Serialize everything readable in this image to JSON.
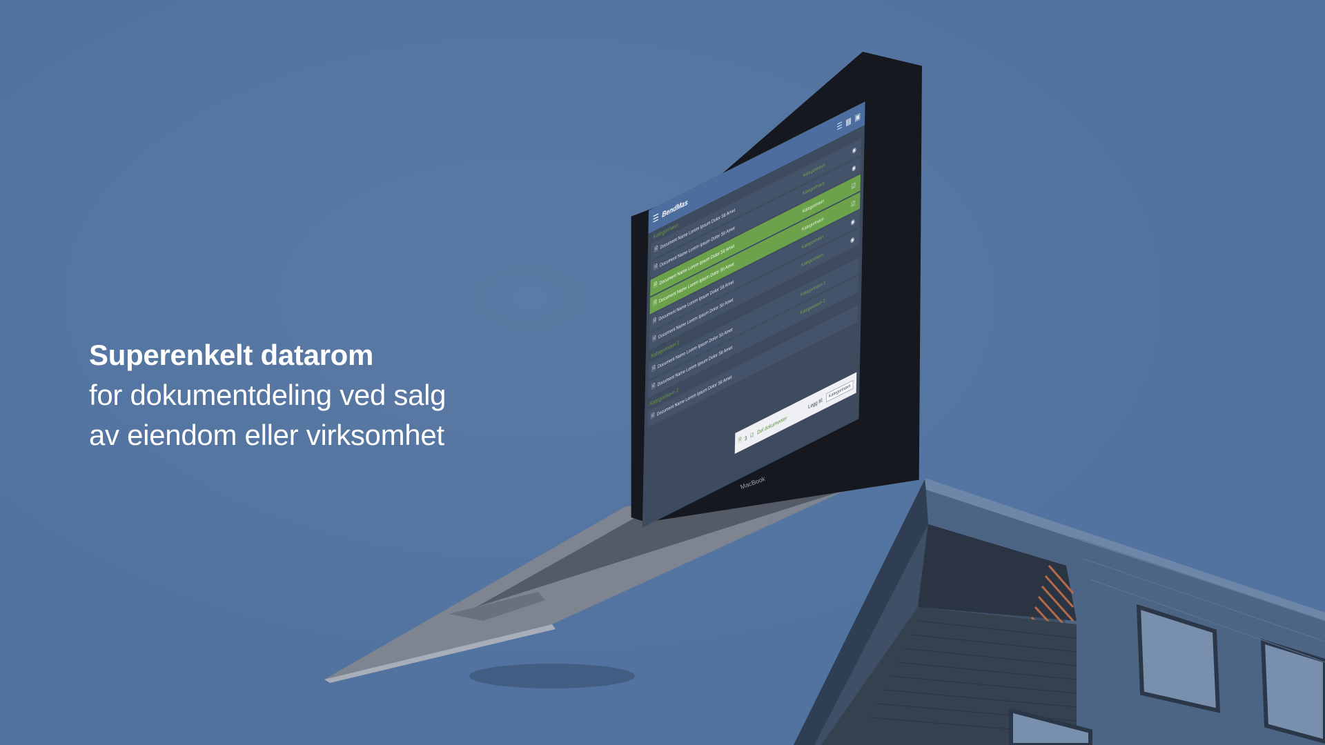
{
  "hero": {
    "title": "Superenkelt datarom",
    "line1": "for dokumentdeling ved salg",
    "line2": "av eiendom eller virksomhet"
  },
  "device": {
    "brand_label": "MacBook"
  },
  "app": {
    "brand": "BendMas",
    "sections": [
      {
        "label": "Kategorinavn",
        "rows": [
          {
            "name": "Document Name Lorem Ipsum Dolor Sit Amet",
            "category": "Kategorinavn",
            "selected": false,
            "action_icon": "eye-icon"
          },
          {
            "name": "Document Name Lorem Ipsum Dolor Sit Amet",
            "category": "Kategorinavn",
            "selected": false,
            "action_icon": "eye-icon"
          },
          {
            "name": "Document Name Lorem Ipsum Dolor Sit Amet",
            "category": "Kategorinavn",
            "selected": true,
            "action_icon": "check-icon"
          },
          {
            "name": "Document Name Lorem Ipsum Dolor Sit Amet",
            "category": "Kategorinavn",
            "selected": true,
            "action_icon": "check-icon"
          },
          {
            "name": "Document Name Lorem Ipsum Dolor Sit Amet",
            "category": "Kategorinavn",
            "selected": false,
            "action_icon": "eye-icon"
          },
          {
            "name": "Document Name Lorem Ipsum Dolor Sit Amet",
            "category": "Kategorinavn",
            "selected": false,
            "action_icon": "eye-icon"
          }
        ]
      },
      {
        "label": "Kategorinavn 1",
        "rows": [
          {
            "name": "Document Name Lorem Ipsum Dolor Sit Amet",
            "category": "Kategorinavn 1",
            "selected": false,
            "action_icon": "eye-icon"
          },
          {
            "name": "Document Name Lorem Ipsum Dolor Sit Amet",
            "category": "Kategorinavn 2",
            "selected": false,
            "action_icon": "eye-icon"
          }
        ]
      },
      {
        "label": "Kategorinavn 2",
        "rows": [
          {
            "name": "Document Name Lorem Ipsum Dolor Sit Amet",
            "category": "",
            "selected": false,
            "action_icon": "eye-icon"
          }
        ]
      }
    ],
    "share_bar": {
      "count": "3",
      "share_label": "Del dokumenter",
      "add_label": "Legg til:",
      "select_value": "Kategorinavn"
    },
    "colors": {
      "header": "#4c6d9e",
      "selected_row": "#6ba24b",
      "row": "#45536a",
      "accent_text": "#79a64f"
    }
  },
  "colors": {
    "background": "#5273a0",
    "text": "#ffffff"
  }
}
